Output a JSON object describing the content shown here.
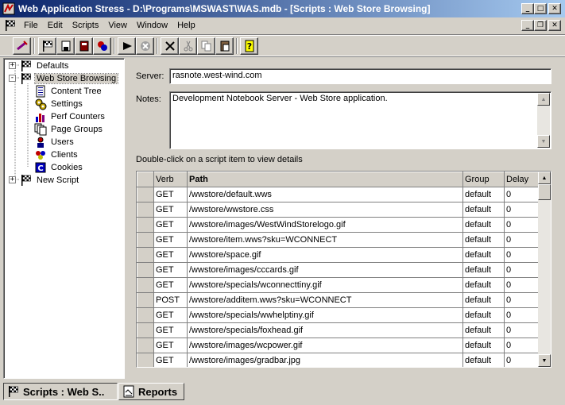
{
  "window": {
    "title": "Web Application Stress - D:\\Programs\\MSWAST\\WAS.mdb - [Scripts : Web Store Browsing]",
    "app_icon": "web-application-stress-icon",
    "caption_buttons": [
      "minimize",
      "maximize",
      "close"
    ]
  },
  "menu": {
    "items": [
      "File",
      "Edit",
      "Scripts",
      "View",
      "Window",
      "Help"
    ]
  },
  "toolbar": {
    "buttons": [
      "new-script-icon",
      "open-script-icon",
      "save-icon",
      "book-icon",
      "wizard-icon",
      "run-icon",
      "stop-icon",
      "delete-icon",
      "cut-icon",
      "copy-icon",
      "paste-icon",
      "help-icon"
    ]
  },
  "tree": {
    "items": [
      {
        "label": "Defaults",
        "icon": "flag-icon",
        "expander": "+"
      },
      {
        "label": "Web Store Browsing",
        "icon": "flag-icon",
        "expander": "-"
      },
      {
        "label": "Content Tree",
        "icon": "content-tree-icon"
      },
      {
        "label": "Settings",
        "icon": "settings-icon"
      },
      {
        "label": "Perf Counters",
        "icon": "perf-counters-icon"
      },
      {
        "label": "Page Groups",
        "icon": "page-groups-icon"
      },
      {
        "label": "Users",
        "icon": "users-icon"
      },
      {
        "label": "Clients",
        "icon": "clients-icon"
      },
      {
        "label": "Cookies",
        "icon": "cookies-icon"
      },
      {
        "label": "New Script",
        "icon": "flag-icon",
        "expander": "+"
      }
    ]
  },
  "details": {
    "server_label": "Server:",
    "server_value": "rasnote.west-wind.com",
    "notes_label": "Notes:",
    "notes_value": "Development Notebook Server - Web Store application.",
    "hint": "Double-click on a script item to view details"
  },
  "grid": {
    "columns": [
      "Verb",
      "Path",
      "Group",
      "Delay"
    ],
    "rows": [
      {
        "verb": "GET",
        "path": "/wwstore/default.wws",
        "group": "default",
        "delay": "0"
      },
      {
        "verb": "GET",
        "path": "/wwstore/wwstore.css",
        "group": "default",
        "delay": "0"
      },
      {
        "verb": "GET",
        "path": "/wwstore/images/WestWindStorelogo.gif",
        "group": "default",
        "delay": "0"
      },
      {
        "verb": "GET",
        "path": "/wwstore/item.wws?sku=WCONNECT",
        "group": "default",
        "delay": "0"
      },
      {
        "verb": "GET",
        "path": "/wwstore/space.gif",
        "group": "default",
        "delay": "0"
      },
      {
        "verb": "GET",
        "path": "/wwstore/images/cccards.gif",
        "group": "default",
        "delay": "0"
      },
      {
        "verb": "GET",
        "path": "/wwstore/specials/wconnecttiny.gif",
        "group": "default",
        "delay": "0"
      },
      {
        "verb": "POST",
        "path": "/wwstore/additem.wws?sku=WCONNECT",
        "group": "default",
        "delay": "0"
      },
      {
        "verb": "GET",
        "path": "/wwstore/specials/wwhelptiny.gif",
        "group": "default",
        "delay": "0"
      },
      {
        "verb": "GET",
        "path": "/wwstore/specials/foxhead.gif",
        "group": "default",
        "delay": "0"
      },
      {
        "verb": "GET",
        "path": "/wwstore/images/wcpower.gif",
        "group": "default",
        "delay": "0"
      },
      {
        "verb": "GET",
        "path": "/wwstore/images/gradbar.jpg",
        "group": "default",
        "delay": "0"
      }
    ]
  },
  "tabs": [
    {
      "label": "Scripts : Web S..",
      "icon": "flag-icon",
      "active": true
    },
    {
      "label": "Reports",
      "icon": "report-icon",
      "active": false
    }
  ],
  "colors": {
    "title_gradient_start": "#0a246a",
    "title_gradient_end": "#a6caf0",
    "face": "#d4d0c8"
  }
}
